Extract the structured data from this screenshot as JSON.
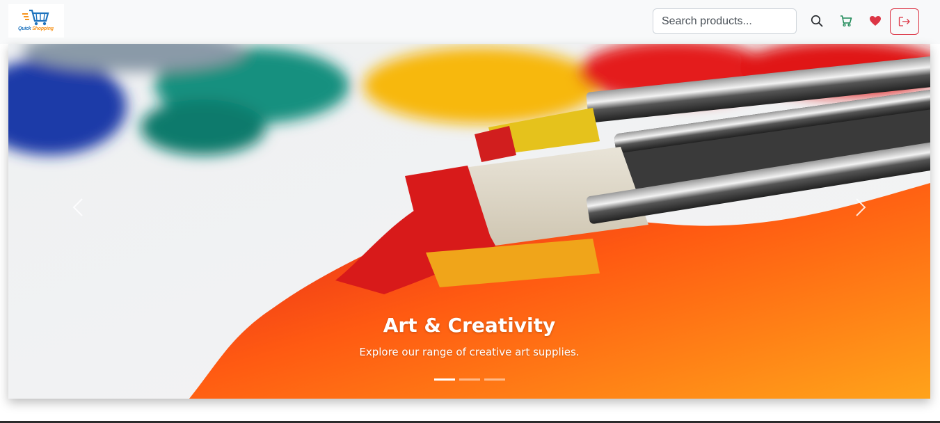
{
  "navbar": {
    "logo": {
      "line1": "Quick",
      "line2": " Shopping",
      "icon": "shopping-cart-logo"
    },
    "search": {
      "placeholder": "Search products...",
      "value": ""
    },
    "icons": {
      "search": "search-icon",
      "cart": "cart-icon",
      "wishlist": "heart-icon",
      "logout": "logout-icon"
    },
    "colors": {
      "cart": "#198754",
      "heart": "#dc3545",
      "logout": "#dc3545"
    }
  },
  "carousel": {
    "active_index": 0,
    "slide_count": 3,
    "slides": [
      {
        "title": "Art & Creativity",
        "text": "Explore our range of creative art supplies."
      }
    ],
    "controls": {
      "prev": "chevron-left-icon",
      "next": "chevron-right-icon"
    }
  }
}
